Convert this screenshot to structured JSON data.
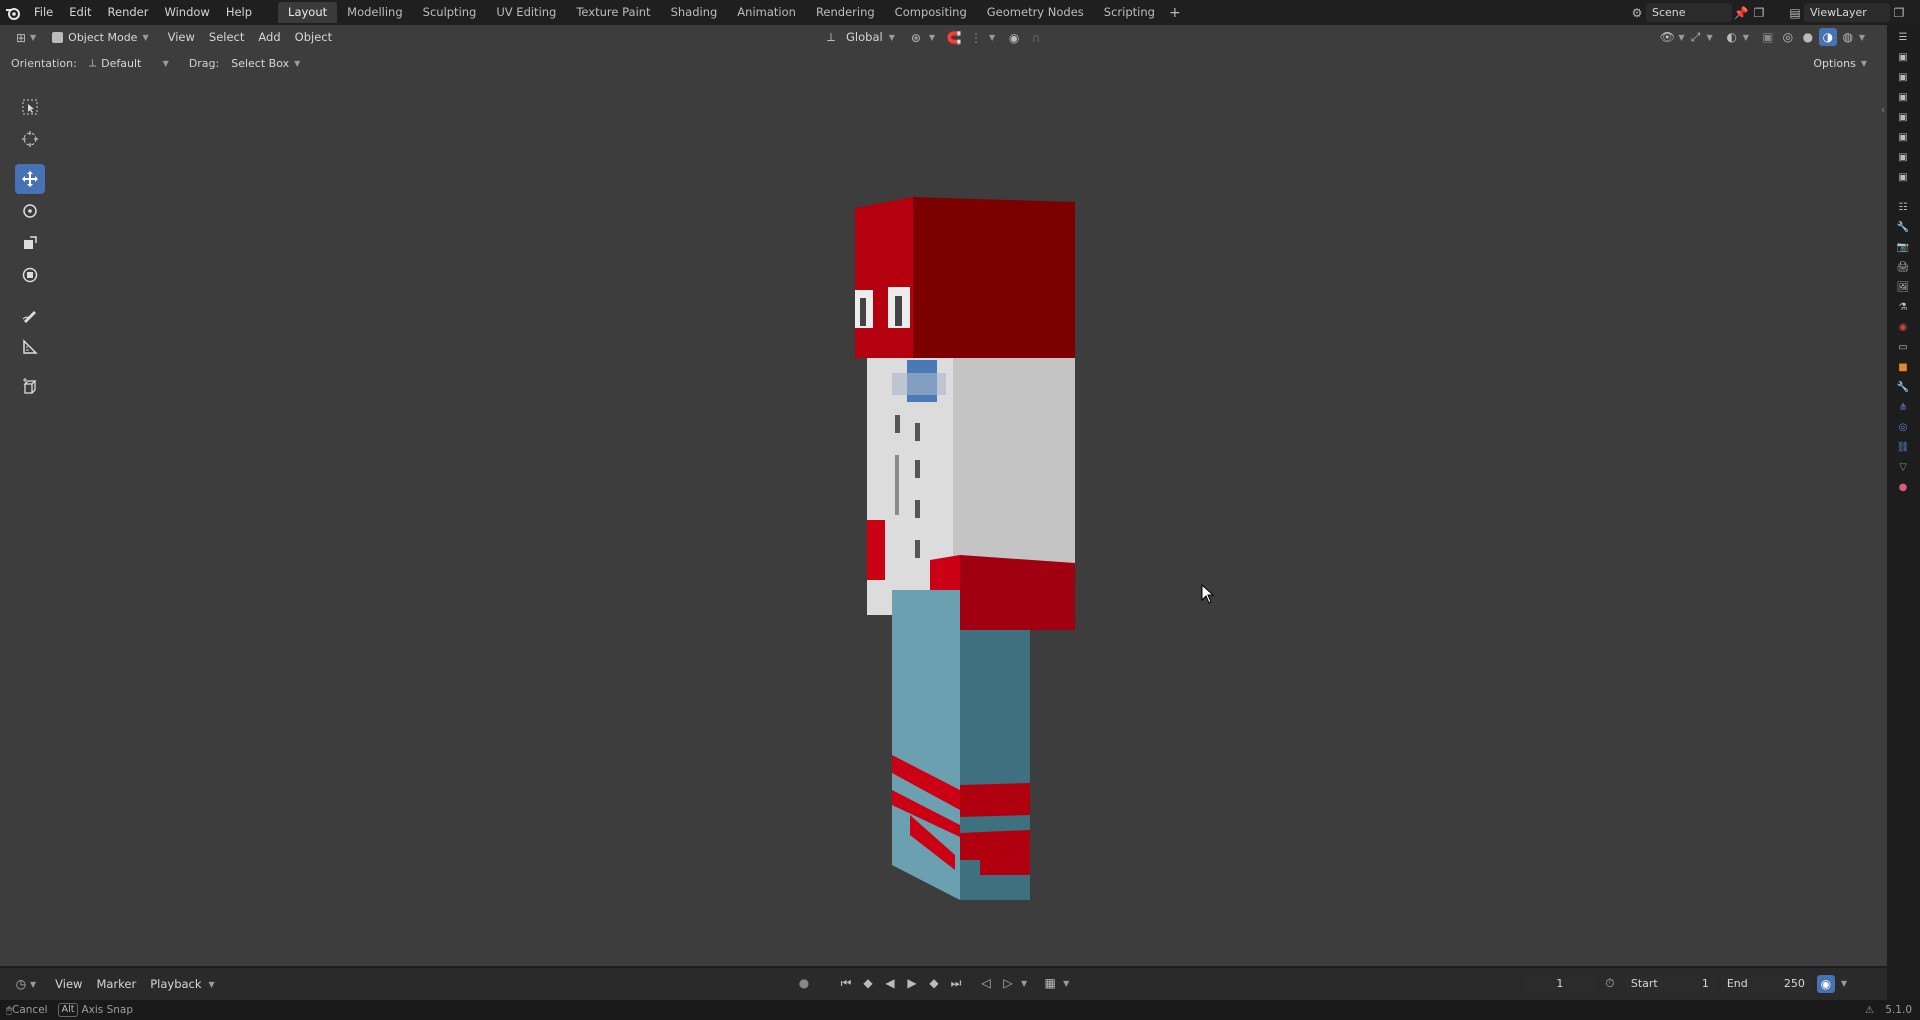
{
  "topbar": {
    "menus": [
      "File",
      "Edit",
      "Render",
      "Window",
      "Help"
    ],
    "workspaces": [
      "Layout",
      "Modelling",
      "Sculpting",
      "UV Editing",
      "Texture Paint",
      "Shading",
      "Animation",
      "Rendering",
      "Compositing",
      "Geometry Nodes",
      "Scripting"
    ],
    "active_workspace": "Layout",
    "scene_name": "Scene",
    "view_layer_name": "ViewLayer"
  },
  "viewport_header": {
    "mode": "Object Mode",
    "menus": [
      "View",
      "Select",
      "Add",
      "Object"
    ],
    "transform_orientation": "Global",
    "options_label": "Options"
  },
  "tool_header": {
    "orientation_label": "Orientation:",
    "orientation_value": "Default",
    "drag_label": "Drag:",
    "drag_value": "Select Box"
  },
  "toolbar": {
    "tools": [
      "select-box",
      "cursor",
      "move",
      "rotate",
      "scale",
      "transform",
      "annotate",
      "measure",
      "add-cube"
    ],
    "active_tool": "move"
  },
  "timeline": {
    "menus": [
      "View",
      "Marker",
      "Playback"
    ],
    "current_frame": "1",
    "start_label": "Start",
    "start_value": "1",
    "end_label": "End",
    "end_value": "250"
  },
  "statusbar": {
    "cancel_label": "Cancel",
    "alt_key": "Alt",
    "axis_snap_label": "Axis Snap",
    "version": "5.1.0"
  },
  "colors": {
    "accent": "#4772b3",
    "viewport_bg": "#3d3d3d",
    "model_red": "#b80012",
    "model_white": "#d9d9d9",
    "model_blue": "#6aa0b0"
  }
}
